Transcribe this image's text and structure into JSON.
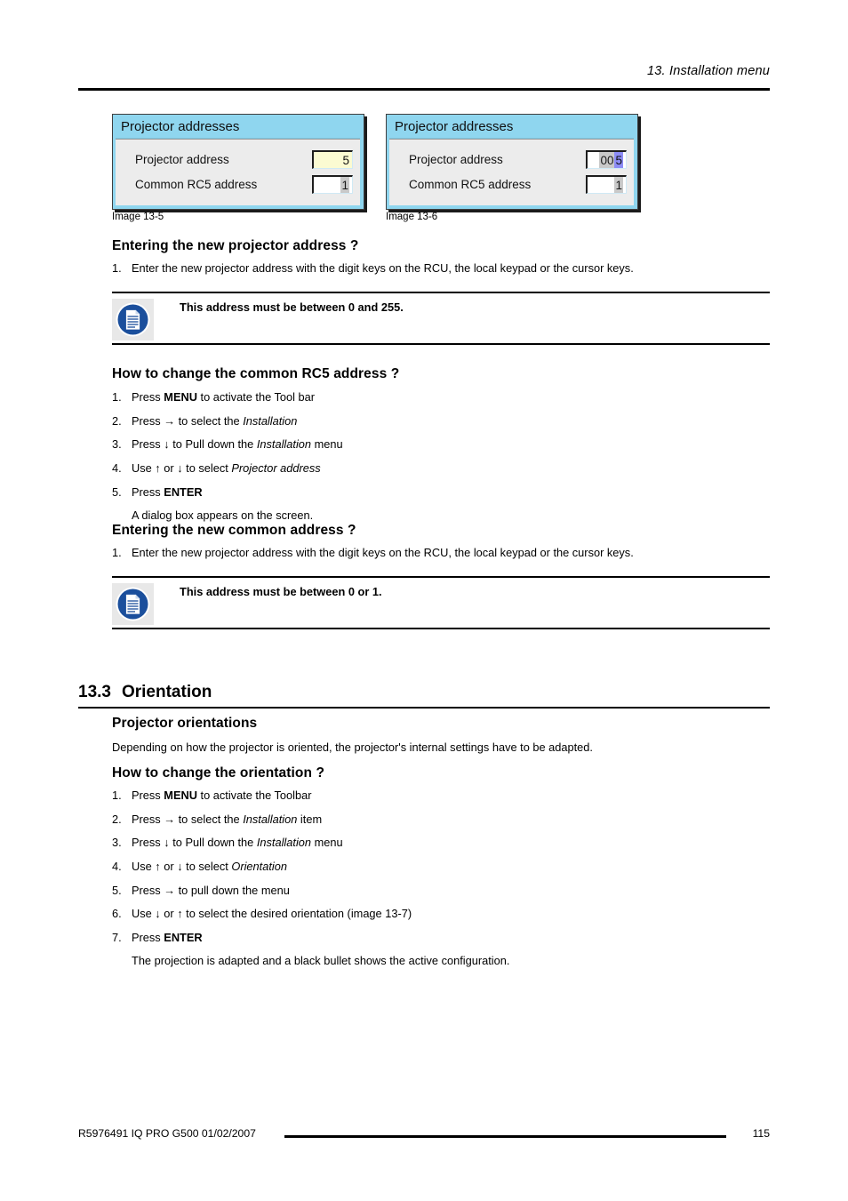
{
  "header": {
    "chapter": "13.  Installation menu"
  },
  "figures": [
    {
      "title": "Projector addresses",
      "rows": [
        {
          "label": "Projector address",
          "value": "5",
          "style": "yellow"
        },
        {
          "label": "Common RC5 address",
          "value": "1",
          "style": "grey-digit"
        }
      ],
      "caption": "Image 13-5"
    },
    {
      "title": "Projector addresses",
      "rows": [
        {
          "label": "Projector address",
          "value": "005",
          "value_prefix": "00",
          "value_selected": "5",
          "style": "selected"
        },
        {
          "label": "Common RC5 address",
          "value": "1",
          "style": "grey-digit"
        }
      ],
      "caption": "Image 13-6"
    }
  ],
  "sections": {
    "entering_projector_address": {
      "heading": "Entering the new projector address ?",
      "steps": [
        {
          "num": "1.",
          "text": "Enter the new projector address with the digit keys on the RCU, the local keypad or the cursor keys."
        }
      ]
    },
    "note_1": {
      "icon": "note-document-icon",
      "text": "This address must be between 0 and 255."
    },
    "change_rc5_address": {
      "heading": "How to change the common RC5 address ?",
      "steps": [
        {
          "num": "1.",
          "pre": "Press ",
          "bold": "MENU",
          "post": " to activate the Tool bar"
        },
        {
          "num": "2.",
          "pre": "Press → to select the ",
          "italic": "Installation",
          "post": ""
        },
        {
          "num": "3.",
          "pre": "Press ↓ to Pull down the ",
          "italic": "Installation",
          "post": " menu"
        },
        {
          "num": "4.",
          "pre": "Use ↑ or ↓ to select ",
          "italic": "Projector address",
          "post": ""
        },
        {
          "num": "5.",
          "pre": "Press ",
          "bold": "ENTER",
          "post": ""
        }
      ],
      "result": "A dialog box appears on the screen."
    },
    "entering_common_address": {
      "heading": "Entering the new common address ?",
      "steps": [
        {
          "num": "1.",
          "text": "Enter the new projector address with the digit keys on the RCU, the local keypad or the cursor keys."
        }
      ]
    },
    "note_2": {
      "icon": "note-document-icon",
      "text": "This address must be between 0 or 1."
    },
    "orientation": {
      "number": "13.3",
      "title": "Orientation",
      "sub_heading": "Projector orientations",
      "intro": "Depending on how the projector is oriented, the projector's internal settings have to be adapted.",
      "how_heading": "How to change the orientation ?",
      "steps": [
        {
          "num": "1.",
          "pre": "Press ",
          "bold": "MENU",
          "post": " to activate the Toolbar"
        },
        {
          "num": "2.",
          "pre": "Press → to select the ",
          "italic": "Installation",
          "post": " item"
        },
        {
          "num": "3.",
          "pre": "Press ↓ to Pull down the ",
          "italic": "Installation",
          "post": " menu"
        },
        {
          "num": "4.",
          "pre": "Use ↑ or ↓ to select ",
          "italic": "Orientation",
          "post": ""
        },
        {
          "num": "5.",
          "pre": "Press → to pull down the menu",
          "italic": "",
          "post": ""
        },
        {
          "num": "6.",
          "pre": "Use ↓ or ↑ to select the desired orientation (image 13-7)",
          "italic": "",
          "post": ""
        },
        {
          "num": "7.",
          "pre": "Press ",
          "bold": "ENTER",
          "post": ""
        }
      ],
      "result": "The projection is adapted and a black bullet shows the active configuration."
    }
  },
  "footer": {
    "left": "R5976491  IQ PRO G500  01/02/2007",
    "page": "115"
  },
  "colors": {
    "dialog_titlebar": "#8fd6ef",
    "dialog_body": "#ececec",
    "field_yellow": "#fbfbd2",
    "selection_blue": "#8c8cf5",
    "note_icon_blue": "#1b4f9c"
  }
}
